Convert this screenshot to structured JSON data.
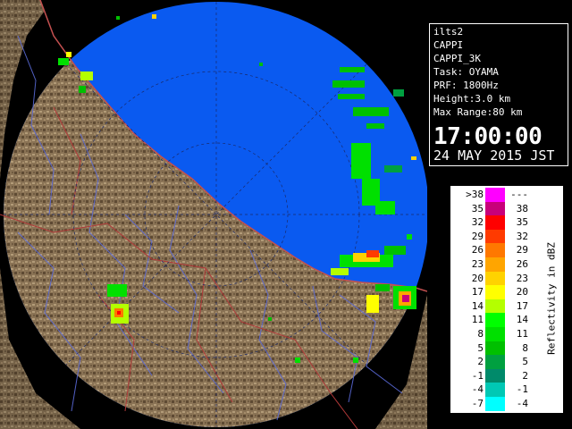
{
  "info": {
    "lines": [
      "ilts2",
      "CAPPI",
      "CAPPI_3K",
      "Task: OYAMA",
      "PRF: 1800Hz",
      "Height:3.0 km",
      "Max Range:80 km"
    ],
    "time": "17:00:00",
    "date": "24 MAY 2015 JST"
  },
  "legend": {
    "unit_label": "Reflectivity in dBZ",
    "rows": [
      {
        "lo": ">38",
        "hi": "---",
        "color": "#ff00ff"
      },
      {
        "lo": "35",
        "hi": "38",
        "color": "#c8007a"
      },
      {
        "lo": "32",
        "hi": "35",
        "color": "#ff0000"
      },
      {
        "lo": "29",
        "hi": "32",
        "color": "#ff3a00"
      },
      {
        "lo": "26",
        "hi": "29",
        "color": "#ff7800"
      },
      {
        "lo": "23",
        "hi": "26",
        "color": "#ffa500"
      },
      {
        "lo": "20",
        "hi": "23",
        "color": "#ffd200"
      },
      {
        "lo": "17",
        "hi": "20",
        "color": "#ffff00"
      },
      {
        "lo": "14",
        "hi": "17",
        "color": "#b4ff00"
      },
      {
        "lo": "11",
        "hi": "14",
        "color": "#00ff00"
      },
      {
        "lo": "8",
        "hi": "11",
        "color": "#00e000"
      },
      {
        "lo": "5",
        "hi": "8",
        "color": "#00c000"
      },
      {
        "lo": "2",
        "hi": "5",
        "color": "#00a040"
      },
      {
        "lo": "-1",
        "hi": "2",
        "color": "#008a6a"
      },
      {
        "lo": "-4",
        "hi": "-1",
        "color": "#00c8b4"
      },
      {
        "lo": "-7",
        "hi": "-4",
        "color": "#00ffff"
      }
    ]
  },
  "map": {
    "sea_color": "#0a5af0",
    "land_color": "#8c7556",
    "out_of_range_color": "#000000"
  }
}
